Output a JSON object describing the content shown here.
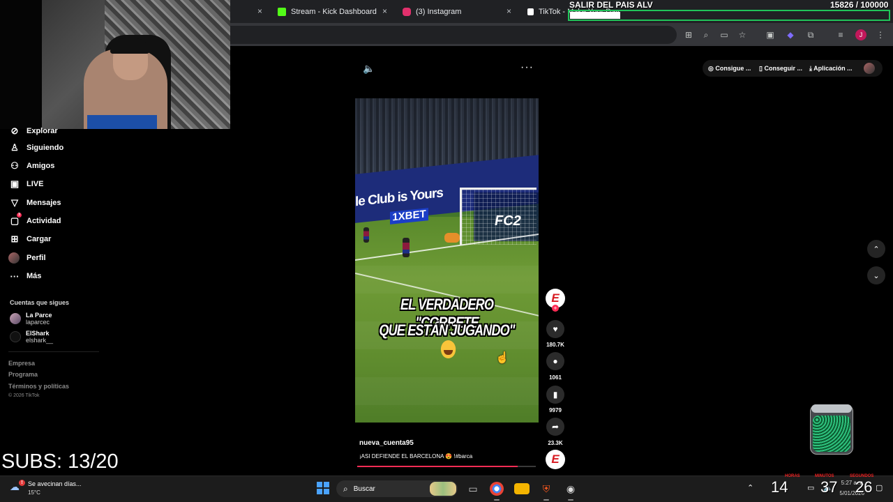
{
  "browser": {
    "tabs": [
      {
        "label": "Stream - Kick Dashboard",
        "favicon_color": "#53fc18"
      },
      {
        "label": "(3) Instagram",
        "favicon_color": "#e1306c"
      },
      {
        "label": "TikTok - Make Your Day",
        "favicon_color": "#ffffff"
      }
    ],
    "close_glyph": "×",
    "toolbar_icons": [
      "translate-icon",
      "zoom-icon",
      "cast-icon",
      "star-icon",
      "extension-icon",
      "media-icon",
      "avatar-icon",
      "menu-icon"
    ],
    "profile_initial": "J"
  },
  "stream_overlay": {
    "goal_title": "SALIR DEL PAIS ALV",
    "goal_count": "15826   / 100000",
    "goal_progress": 0.158,
    "subs": "SUBS: 13/20",
    "timer": {
      "labels": [
        "HORAS",
        "MINUTOS",
        "SEGUNDOS"
      ],
      "values": [
        "14",
        "37",
        "26"
      ]
    }
  },
  "sidebar": {
    "items": [
      {
        "label": "Explorar",
        "icon": "compass-icon"
      },
      {
        "label": "Siguiendo",
        "icon": "following-icon"
      },
      {
        "label": "Amigos",
        "icon": "friends-icon"
      },
      {
        "label": "LIVE",
        "icon": "live-icon"
      },
      {
        "label": "Mensajes",
        "icon": "messages-icon"
      },
      {
        "label": "Actividad",
        "icon": "activity-icon",
        "badge": "3"
      },
      {
        "label": "Cargar",
        "icon": "upload-icon"
      },
      {
        "label": "Perfil",
        "icon": "profile-icon"
      },
      {
        "label": "Más",
        "icon": "more-icon"
      }
    ],
    "following_title": "Cuentas que sigues",
    "following": [
      {
        "name": "La Parce",
        "username": "laparcec"
      },
      {
        "name": "ElShark",
        "username": "elshark__"
      }
    ],
    "footer": [
      "Empresa",
      "Programa",
      "Términos y políticas"
    ],
    "copyright": "© 2026 TikTok"
  },
  "top_links": [
    "Consigue ...",
    "Conseguir ...",
    "Aplicación ..."
  ],
  "video": {
    "board_text": "le Club is Yours",
    "board_sponsor": "1XBET",
    "ad_text": "FC2",
    "caption_line1": "EL VERDADERO \"CORRETE",
    "caption_line2": "QUE ESTÁN JUGANDO\"",
    "author": "nueva_cuenta95",
    "description": "¡ASI DEFIENDE EL BARCELONA 😍 !#barca",
    "progress": 0.9
  },
  "actions": {
    "likes": "180.7K",
    "comments": "1061",
    "saves": "9979",
    "shares": "23.3K",
    "avatar_logo": "E"
  },
  "taskbar": {
    "weather_text": "Se avecinan días...",
    "weather_temp": "15°C",
    "weather_badge": "!",
    "search_label": "Buscar",
    "clock_time": "5:27 a.m.",
    "clock_date": "5/01/2026"
  }
}
